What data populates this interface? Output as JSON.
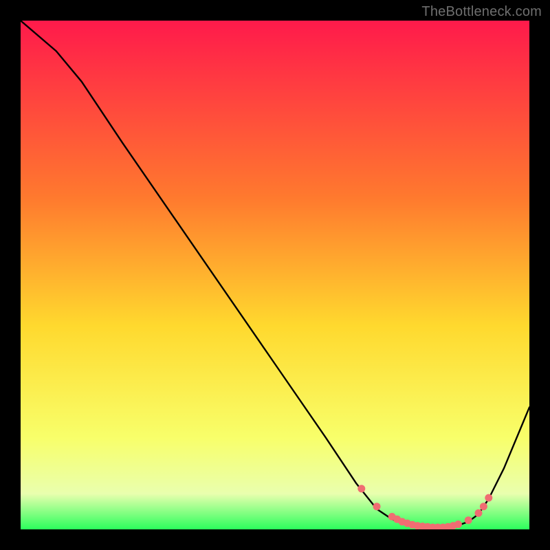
{
  "attribution": "TheBottleneck.com",
  "colors": {
    "gradient_top": "#ff1a4b",
    "gradient_mid_hi": "#ff7a2e",
    "gradient_mid": "#ffd92e",
    "gradient_mid_lo": "#f8ff6a",
    "gradient_low": "#e9ffae",
    "gradient_bottom": "#2bff5c",
    "curve": "#000000",
    "marker_fill": "#f06d72",
    "marker_stroke": "#f06d72"
  },
  "chart_data": {
    "type": "line",
    "title": "",
    "xlabel": "",
    "ylabel": "",
    "xlim": [
      0,
      100
    ],
    "ylim": [
      0,
      100
    ],
    "curve": {
      "x": [
        0,
        7,
        12,
        20,
        30,
        40,
        50,
        60,
        66,
        70,
        73,
        75,
        78,
        80,
        82,
        84,
        86,
        88,
        90,
        92,
        95,
        100
      ],
      "y": [
        100,
        94,
        88,
        76,
        61.5,
        47,
        32.5,
        18,
        9,
        4,
        2,
        1.2,
        0.6,
        0.4,
        0.3,
        0.4,
        0.8,
        1.5,
        3,
        6,
        12,
        24
      ]
    },
    "markers": {
      "x": [
        67,
        70,
        73,
        74,
        75,
        76,
        77,
        78,
        79,
        80,
        81,
        82,
        83,
        84,
        85,
        86,
        88,
        90,
        91,
        92
      ],
      "y": [
        8,
        4.5,
        2.5,
        2.0,
        1.5,
        1.2,
        0.9,
        0.7,
        0.6,
        0.5,
        0.4,
        0.4,
        0.4,
        0.5,
        0.7,
        1.0,
        1.8,
        3.2,
        4.5,
        6.2
      ]
    }
  }
}
